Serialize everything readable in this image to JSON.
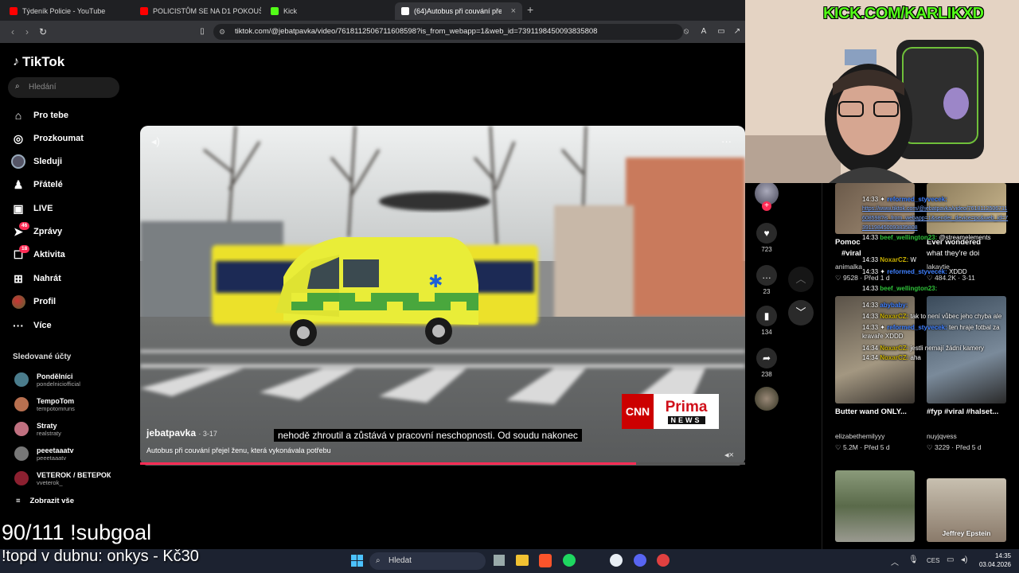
{
  "browser": {
    "tabs": [
      {
        "label": "Týdeník Policie - YouTube",
        "fav": "#ff0000"
      },
      {
        "label": "POLICISTŮM SE NA D1 POKOUŠEL U",
        "fav": "#ff0000"
      },
      {
        "label": "Kick",
        "fav": "#53fc18"
      },
      {
        "label": "(64)Autobus při couvání přej",
        "fav": "#ffffff",
        "close": "×"
      }
    ],
    "new_tab": "+",
    "url": "tiktok.com/@jebatpavka/video/7618112506711608598?is_from_webapp=1&web_id=7391198450093835808"
  },
  "tiktok": {
    "logo": "TikTok",
    "search_placeholder": "Hledání",
    "nav": [
      {
        "label": "Pro tebe",
        "icon": "home-icon",
        "glyph": "⌂"
      },
      {
        "label": "Prozkoumat",
        "icon": "compass-icon",
        "glyph": "◎"
      },
      {
        "label": "Sleduji",
        "icon": "following-avatar-icon",
        "glyph": "●"
      },
      {
        "label": "Přátelé",
        "icon": "friends-icon",
        "glyph": "♟"
      },
      {
        "label": "LIVE",
        "icon": "live-icon",
        "glyph": "▣"
      },
      {
        "label": "Zprávy",
        "icon": "messages-icon",
        "glyph": "➤",
        "badge": "46"
      },
      {
        "label": "Aktivita",
        "icon": "activity-icon",
        "glyph": "☐",
        "badge": "18"
      },
      {
        "label": "Nahrát",
        "icon": "upload-icon",
        "glyph": "⊞"
      },
      {
        "label": "Profil",
        "icon": "profile-avatar-icon",
        "glyph": "●"
      },
      {
        "label": "Více",
        "icon": "more-icon",
        "glyph": "···"
      }
    ],
    "following_title": "Sledované účty",
    "following": [
      {
        "name": "Pondělníci",
        "handle": "pondelniciofficial",
        "color": "#4a7c8c"
      },
      {
        "name": "TempoTom",
        "handle": "tempotomruns",
        "color": "#b87050"
      },
      {
        "name": "Straty",
        "handle": "realstraty",
        "color": "#c07080"
      },
      {
        "name": "peeetaaatv",
        "handle": "peeetaaatv",
        "color": "#777777"
      },
      {
        "name": "VETEROK / ВЕТЕРОК",
        "handle": "vveterok_",
        "color": "#8c2030"
      }
    ],
    "show_all": "Zobrazit vše",
    "video": {
      "author": "jebatpavka",
      "date": "3-17",
      "caption": "Autobus při couvání přejel ženu, která vykonávala potřebu",
      "subtitle": "nehodě zhroutil a zůstává v pracovní neschopnosti. Od soudu nakonec",
      "logo_cnn": "CNN",
      "logo_prima": "Prima",
      "logo_news": "NEWS",
      "progress": 0.82
    },
    "actions": {
      "likes": "723",
      "comments": "23",
      "saves": "134",
      "shares": "238"
    },
    "grid": [
      {
        "title": "Pomoc",
        "sub": "#viral",
        "author": "animalka",
        "likes": "9528",
        "when": "Před 1 d"
      },
      {
        "title": "Ever wondered",
        "sub": "what they're doi",
        "author": "lakaytie_",
        "likes": "484.2K",
        "when": "3-11"
      },
      {
        "title": "Butter wand ONLY...",
        "author": "elizabethemilyyy",
        "likes": "5.2M",
        "when": "Před 5 d"
      },
      {
        "title": "#fyp #viral #halset...",
        "author": "nuyjqvess",
        "likes": "3229",
        "when": "Před 5 d"
      },
      {
        "title": "",
        "author": "",
        "likes": "",
        "when": ""
      },
      {
        "title": "Jeffrey Epstein",
        "author": "",
        "likes": "",
        "when": ""
      }
    ]
  },
  "stream": {
    "kick_url": "KICK.COM/KARLIKXD",
    "subgoal": "90/111 !subgoal",
    "topd": "!topd v dubnu: onkys - Kč30",
    "chat": [
      {
        "time": "14:33",
        "user": "reformed_styvecek:",
        "msg": "https://www.tiktok.com/@jebatpavka/video/7618112506711608598?is_from_webapp=1&sender_device=pc&web_id=7391198450093835808"
      },
      {
        "time": "14:33",
        "user": "beef_wellington23:",
        "msg": "@streamelements"
      },
      {
        "time": "14:33",
        "user": "NoxarCZ:",
        "msg": "W"
      },
      {
        "time": "14:33",
        "user": "reformed_styvecek:",
        "msg": "XDDD"
      },
      {
        "time": "14:33",
        "user": "beef_wellington23:",
        "msg": ""
      },
      {
        "time": "14:33",
        "user": "abybaby:",
        "msg": ""
      },
      {
        "time": "14:33",
        "user": "NoxarCZ:",
        "msg": "tak to není vůbec jeho chyba ale"
      },
      {
        "time": "14:33",
        "user": "reformed_styvecek:",
        "msg": "ten hraje fotbal za kravaře XDDD"
      },
      {
        "time": "14:34",
        "user": "NoxarCZ:",
        "msg": "jestli nemají žádní kamery"
      },
      {
        "time": "14:34",
        "user": "NoxarCZ:",
        "msg": "aha"
      }
    ]
  },
  "taskbar": {
    "search": "Hledat",
    "lang": "CES",
    "time": "14:35",
    "date": "03.04.2026"
  }
}
